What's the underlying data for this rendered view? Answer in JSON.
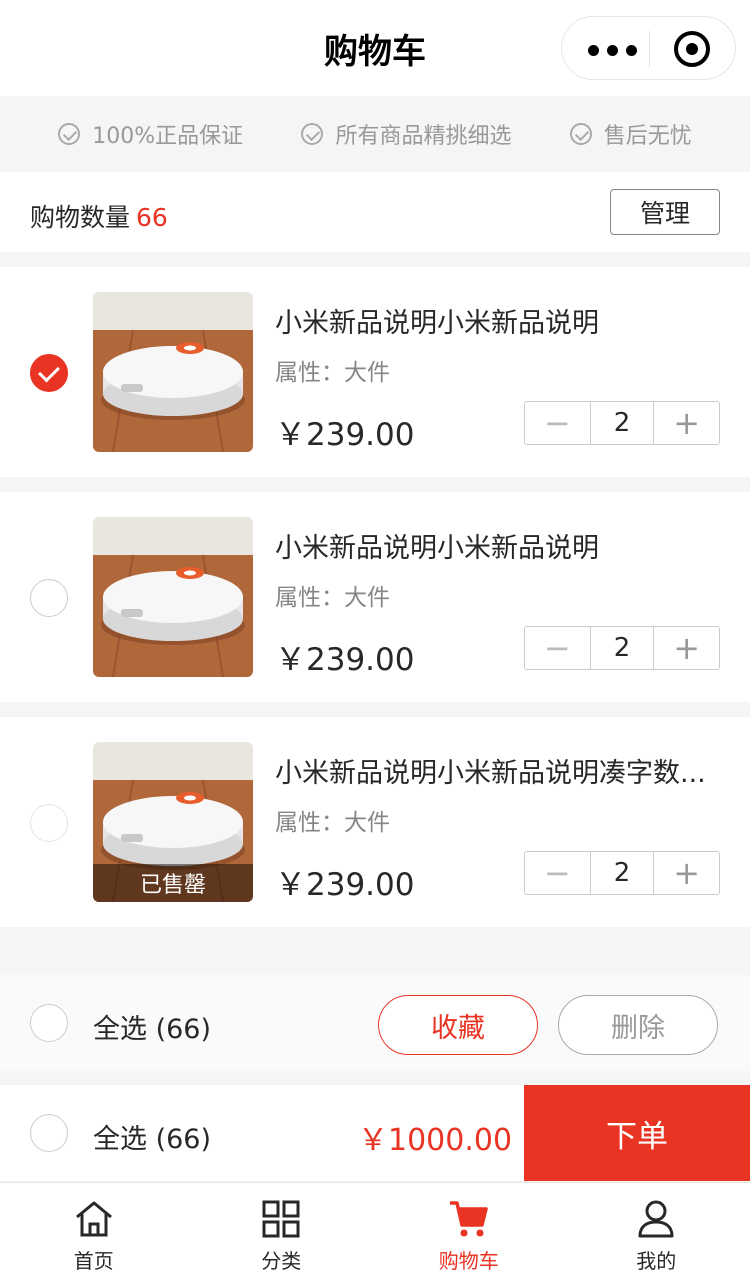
{
  "nav": {
    "title": "购物车"
  },
  "guarantees": [
    "100%正品保证",
    "所有商品精挑细选",
    "售后无忧"
  ],
  "count_bar": {
    "label": "购物数量",
    "count": "66",
    "manage_label": "管理"
  },
  "items": [
    {
      "name": "小米新品说明小米新品说明",
      "attr": "属性：大件",
      "price": "￥239.00",
      "qty": "2",
      "checked": true,
      "sold_out": ""
    },
    {
      "name": "小米新品说明小米新品说明",
      "attr": "属性：大件",
      "price": "￥239.00",
      "qty": "2",
      "checked": false,
      "sold_out": ""
    },
    {
      "name": "小米新品说明小米新品说明凑字数...",
      "attr": "属性：大件",
      "price": "￥239.00",
      "qty": "2",
      "checked": false,
      "sold_out": "已售罄"
    }
  ],
  "action_bar": {
    "select_all": "全选 (66)",
    "favorite": "收藏",
    "delete": "删除"
  },
  "order_bar": {
    "select_all": "全选 (66)",
    "total": "￥1000.00",
    "order": "下单"
  },
  "tabbar": [
    {
      "label": "首页",
      "icon": "home-icon",
      "active": false
    },
    {
      "label": "分类",
      "icon": "category-grid-icon",
      "active": false
    },
    {
      "label": "购物车",
      "icon": "cart-icon",
      "active": true
    },
    {
      "label": "我的",
      "icon": "user-icon",
      "active": false
    }
  ],
  "colors": {
    "accent": "#e93323",
    "text": "#282828",
    "muted": "#868686"
  }
}
